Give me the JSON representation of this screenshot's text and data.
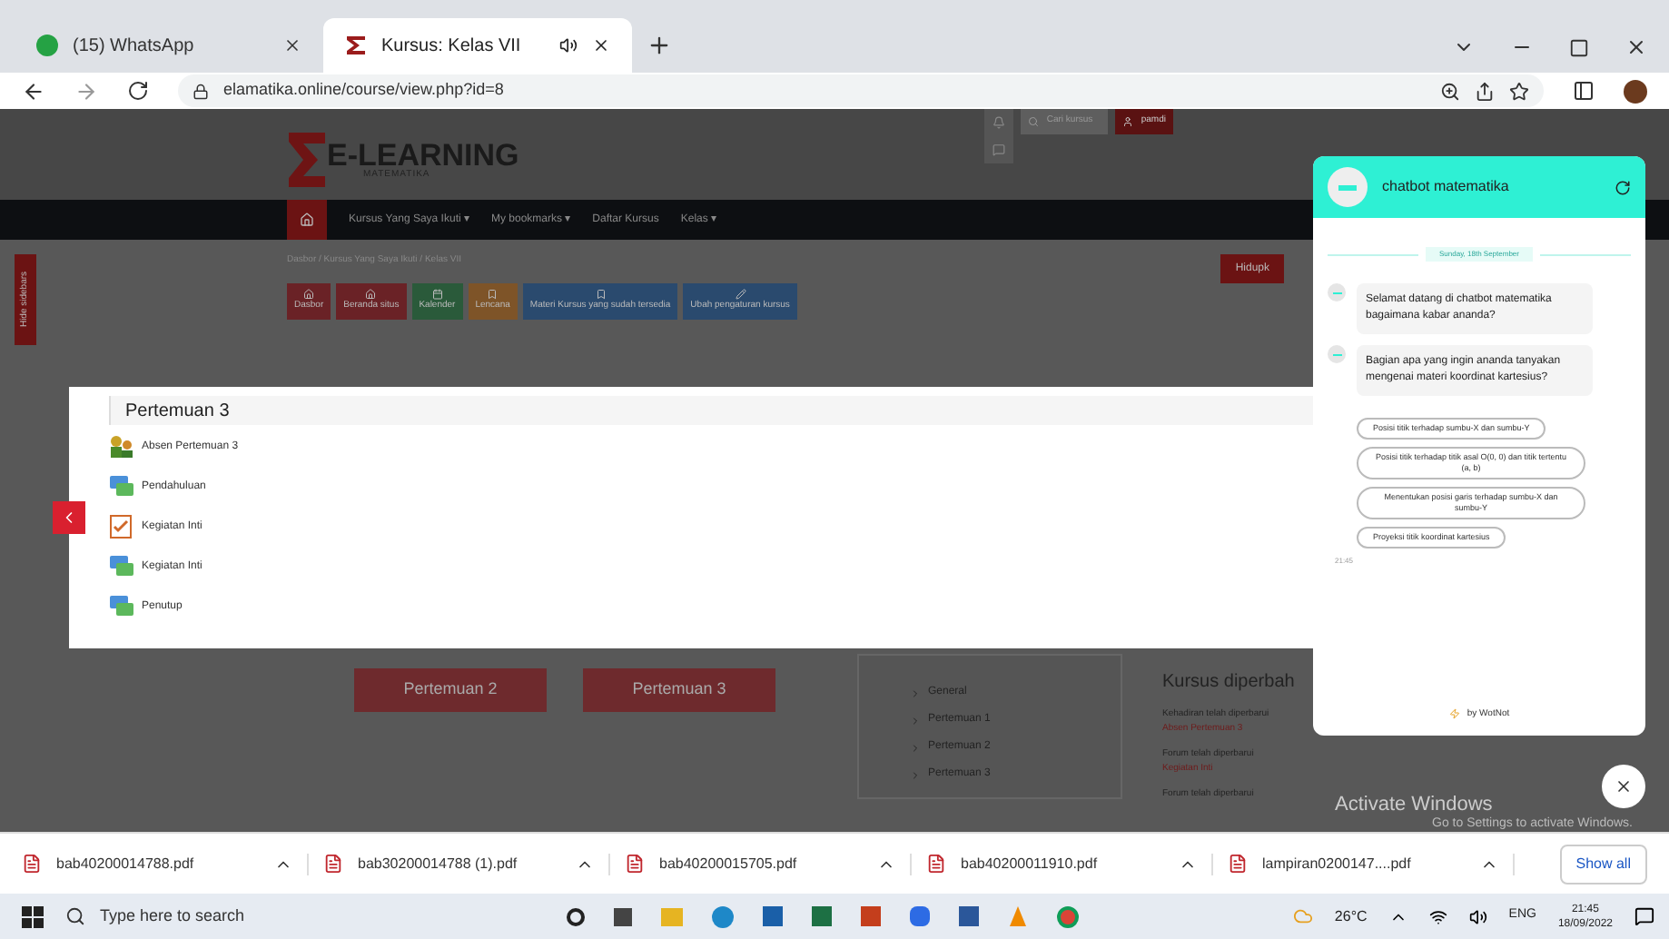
{
  "browser": {
    "tabs": [
      {
        "title": "(15) WhatsApp",
        "selected": false,
        "kind": "whatsapp"
      },
      {
        "title": "Kursus: Kelas VII",
        "selected": true,
        "kind": "elearning"
      }
    ],
    "url": "elamatika.online/course/view.php?id=8"
  },
  "site": {
    "logo_title": "E-LEARNING",
    "logo_subtitle": "MATEMATIKA",
    "search_placeholder": "Cari kursus",
    "user": "pamdi",
    "nav": [
      "Kursus Yang Saya Ikuti ▾",
      "My bookmarks ▾",
      "Daftar Kursus",
      "Kelas ▾"
    ],
    "sidebar_toggle": "Hide sidebars",
    "breadcrumb": "Dasbor / Kursus Yang Saya Ikuti / Kelas VII",
    "quick_buttons": [
      {
        "label": "Dasbor",
        "color": "#6a2226"
      },
      {
        "label": "Beranda situs",
        "color": "#6a2226"
      },
      {
        "label": "Kalender",
        "color": "#2a5a3a"
      },
      {
        "label": "Lencana",
        "color": "#7e5428"
      },
      {
        "label": "Materi Kursus yang sudah tersedia",
        "color": "#2a4a6e"
      },
      {
        "label": "Ubah pengaturan kursus",
        "color": "#2a4a6e"
      }
    ],
    "edit_button": "Hidupk",
    "section_buttons": [
      "Pertemuan 2",
      "Pertemuan 3"
    ],
    "toc": [
      "General",
      "Pertemuan 1",
      "Pertemuan 2",
      "Pertemuan 3"
    ],
    "updates_title": "Kursus diperbah",
    "updates": [
      {
        "text": "Kehadiran telah diperbarui",
        "link": "Absen Pertemuan 3"
      },
      {
        "text": "Forum telah diperbarui",
        "link": "Kegiatan Inti"
      },
      {
        "text": "Forum telah diperbarui"
      }
    ]
  },
  "modal": {
    "title": "Pertemuan 3",
    "items": [
      {
        "label": "Absen Pertemuan 3",
        "kind": "attendance"
      },
      {
        "label": "Pendahuluan",
        "kind": "forum"
      },
      {
        "label": "Kegiatan Inti",
        "kind": "quiz"
      },
      {
        "label": "Kegiatan Inti",
        "kind": "forum"
      },
      {
        "label": "Penutup",
        "kind": "forum"
      }
    ]
  },
  "chatbot": {
    "title": "chatbot matematika",
    "date": "Sunday, 18th September",
    "messages": [
      "Selamat datang di chatbot matematika\nbagaimana kabar ananda?",
      "Bagian apa yang ingin ananda tanyakan mengenai materi koordinat kartesius?"
    ],
    "options": [
      "Posisi titik terhadap sumbu-X dan sumbu-Y",
      "Posisi titik terhadap titik asal O(0, 0) dan titik tertentu (a, b)",
      "Menentukan posisi garis terhadap sumbu-X dan sumbu-Y",
      "Proyeksi titik koordinat kartesius"
    ],
    "time": "21:45",
    "footer": "by WotNot"
  },
  "activation": {
    "title": "Activate Windows",
    "subtitle": "Go to Settings to activate Windows."
  },
  "downloads": {
    "files": [
      "bab40200014788.pdf",
      "bab30200014788 (1).pdf",
      "bab40200015705.pdf",
      "bab40200011910.pdf",
      "lampiran0200147....pdf"
    ],
    "show_all": "Show all"
  },
  "taskbar": {
    "search_placeholder": "Type here to search",
    "temperature": "26°C",
    "language": "ENG",
    "time": "21:45",
    "date": "18/09/2022"
  }
}
